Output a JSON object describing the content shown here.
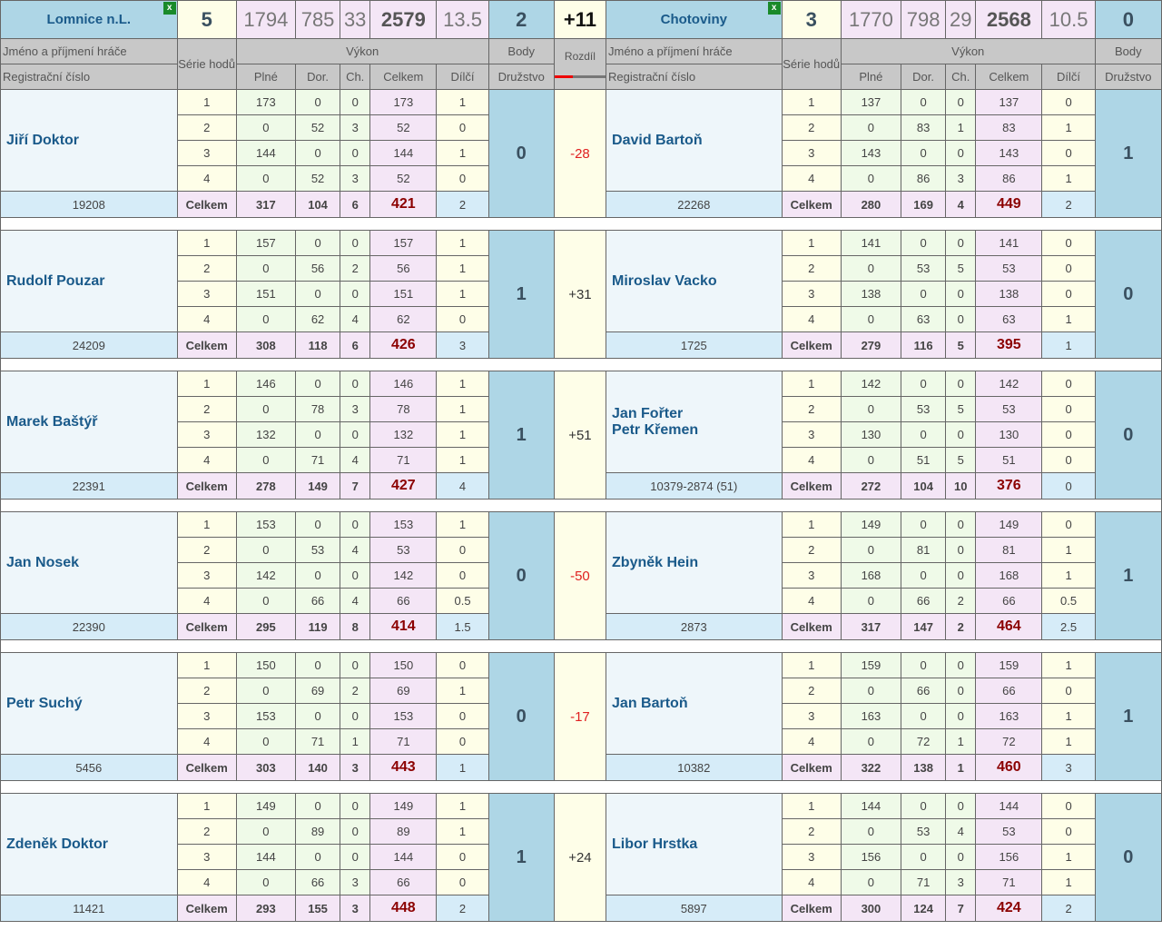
{
  "header": {
    "home": {
      "name": "Lomnice n.L.",
      "icon": "excel-icon",
      "icon_glyph": "x",
      "points": "5",
      "plne": "1794",
      "dor": "785",
      "ch": "33",
      "celkem": "2579",
      "dilci": "13.5",
      "body": "2"
    },
    "diff": "+11",
    "away": {
      "name": "Chotoviny",
      "icon": "excel-icon",
      "icon_glyph": "x",
      "points": "3",
      "plne": "1770",
      "dor": "798",
      "ch": "29",
      "celkem": "2568",
      "dilci": "10.5",
      "body": "0"
    }
  },
  "labels": {
    "player": "Jméno a příjmení hráče",
    "reg": "Registrační číslo",
    "serie": "Série hodů",
    "vykon": "Výkon",
    "body": "Body",
    "druzstvo": "Družstvo",
    "rozdil": "Rozdíl",
    "plne": "Plné",
    "dor": "Dor.",
    "ch": "Ch.",
    "celkem": "Celkem",
    "dilci": "Dílčí",
    "total_label": "Celkem"
  },
  "matches": [
    {
      "diff": "-28",
      "home": {
        "names": [
          "Jiří Doktor"
        ],
        "reg": "19208",
        "points": "0",
        "rows": [
          [
            "1",
            "173",
            "0",
            "0",
            "173",
            "1"
          ],
          [
            "2",
            "0",
            "52",
            "3",
            "52",
            "0"
          ],
          [
            "3",
            "144",
            "0",
            "0",
            "144",
            "1"
          ],
          [
            "4",
            "0",
            "52",
            "3",
            "52",
            "0"
          ]
        ],
        "total": [
          "317",
          "104",
          "6",
          "421",
          "2"
        ]
      },
      "away": {
        "names": [
          "David Bartoň"
        ],
        "reg": "22268",
        "points": "1",
        "rows": [
          [
            "1",
            "137",
            "0",
            "0",
            "137",
            "0"
          ],
          [
            "2",
            "0",
            "83",
            "1",
            "83",
            "1"
          ],
          [
            "3",
            "143",
            "0",
            "0",
            "143",
            "0"
          ],
          [
            "4",
            "0",
            "86",
            "3",
            "86",
            "1"
          ]
        ],
        "total": [
          "280",
          "169",
          "4",
          "449",
          "2"
        ]
      }
    },
    {
      "diff": "+31",
      "home": {
        "names": [
          "Rudolf Pouzar"
        ],
        "reg": "24209",
        "points": "1",
        "rows": [
          [
            "1",
            "157",
            "0",
            "0",
            "157",
            "1"
          ],
          [
            "2",
            "0",
            "56",
            "2",
            "56",
            "1"
          ],
          [
            "3",
            "151",
            "0",
            "0",
            "151",
            "1"
          ],
          [
            "4",
            "0",
            "62",
            "4",
            "62",
            "0"
          ]
        ],
        "total": [
          "308",
          "118",
          "6",
          "426",
          "3"
        ]
      },
      "away": {
        "names": [
          "Miroslav Vacko"
        ],
        "reg": "1725",
        "points": "0",
        "rows": [
          [
            "1",
            "141",
            "0",
            "0",
            "141",
            "0"
          ],
          [
            "2",
            "0",
            "53",
            "5",
            "53",
            "0"
          ],
          [
            "3",
            "138",
            "0",
            "0",
            "138",
            "0"
          ],
          [
            "4",
            "0",
            "63",
            "0",
            "63",
            "1"
          ]
        ],
        "total": [
          "279",
          "116",
          "5",
          "395",
          "1"
        ]
      }
    },
    {
      "diff": "+51",
      "home": {
        "names": [
          "Marek Baštýř"
        ],
        "reg": "22391",
        "points": "1",
        "rows": [
          [
            "1",
            "146",
            "0",
            "0",
            "146",
            "1"
          ],
          [
            "2",
            "0",
            "78",
            "3",
            "78",
            "1"
          ],
          [
            "3",
            "132",
            "0",
            "0",
            "132",
            "1"
          ],
          [
            "4",
            "0",
            "71",
            "4",
            "71",
            "1"
          ]
        ],
        "total": [
          "278",
          "149",
          "7",
          "427",
          "4"
        ]
      },
      "away": {
        "names": [
          "Jan Fořter",
          "Petr Křemen"
        ],
        "reg": "10379-2874 (51)",
        "points": "0",
        "rows": [
          [
            "1",
            "142",
            "0",
            "0",
            "142",
            "0"
          ],
          [
            "2",
            "0",
            "53",
            "5",
            "53",
            "0"
          ],
          [
            "3",
            "130",
            "0",
            "0",
            "130",
            "0"
          ],
          [
            "4",
            "0",
            "51",
            "5",
            "51",
            "0"
          ]
        ],
        "total": [
          "272",
          "104",
          "10",
          "376",
          "0"
        ]
      }
    },
    {
      "diff": "-50",
      "home": {
        "names": [
          "Jan Nosek"
        ],
        "reg": "22390",
        "points": "0",
        "rows": [
          [
            "1",
            "153",
            "0",
            "0",
            "153",
            "1"
          ],
          [
            "2",
            "0",
            "53",
            "4",
            "53",
            "0"
          ],
          [
            "3",
            "142",
            "0",
            "0",
            "142",
            "0"
          ],
          [
            "4",
            "0",
            "66",
            "4",
            "66",
            "0.5"
          ]
        ],
        "total": [
          "295",
          "119",
          "8",
          "414",
          "1.5"
        ]
      },
      "away": {
        "names": [
          "Zbyněk Hein"
        ],
        "reg": "2873",
        "points": "1",
        "rows": [
          [
            "1",
            "149",
            "0",
            "0",
            "149",
            "0"
          ],
          [
            "2",
            "0",
            "81",
            "0",
            "81",
            "1"
          ],
          [
            "3",
            "168",
            "0",
            "0",
            "168",
            "1"
          ],
          [
            "4",
            "0",
            "66",
            "2",
            "66",
            "0.5"
          ]
        ],
        "total": [
          "317",
          "147",
          "2",
          "464",
          "2.5"
        ]
      }
    },
    {
      "diff": "-17",
      "home": {
        "names": [
          "Petr Suchý"
        ],
        "reg": "5456",
        "points": "0",
        "rows": [
          [
            "1",
            "150",
            "0",
            "0",
            "150",
            "0"
          ],
          [
            "2",
            "0",
            "69",
            "2",
            "69",
            "1"
          ],
          [
            "3",
            "153",
            "0",
            "0",
            "153",
            "0"
          ],
          [
            "4",
            "0",
            "71",
            "1",
            "71",
            "0"
          ]
        ],
        "total": [
          "303",
          "140",
          "3",
          "443",
          "1"
        ]
      },
      "away": {
        "names": [
          "Jan Bartoň"
        ],
        "reg": "10382",
        "points": "1",
        "rows": [
          [
            "1",
            "159",
            "0",
            "0",
            "159",
            "1"
          ],
          [
            "2",
            "0",
            "66",
            "0",
            "66",
            "0"
          ],
          [
            "3",
            "163",
            "0",
            "0",
            "163",
            "1"
          ],
          [
            "4",
            "0",
            "72",
            "1",
            "72",
            "1"
          ]
        ],
        "total": [
          "322",
          "138",
          "1",
          "460",
          "3"
        ]
      }
    },
    {
      "diff": "+24",
      "home": {
        "names": [
          "Zdeněk Doktor"
        ],
        "reg": "11421",
        "points": "1",
        "rows": [
          [
            "1",
            "149",
            "0",
            "0",
            "149",
            "1"
          ],
          [
            "2",
            "0",
            "89",
            "0",
            "89",
            "1"
          ],
          [
            "3",
            "144",
            "0",
            "0",
            "144",
            "0"
          ],
          [
            "4",
            "0",
            "66",
            "3",
            "66",
            "0"
          ]
        ],
        "total": [
          "293",
          "155",
          "3",
          "448",
          "2"
        ]
      },
      "away": {
        "names": [
          "Libor Hrstka"
        ],
        "reg": "5897",
        "points": "0",
        "rows": [
          [
            "1",
            "144",
            "0",
            "0",
            "144",
            "0"
          ],
          [
            "2",
            "0",
            "53",
            "4",
            "53",
            "0"
          ],
          [
            "3",
            "156",
            "0",
            "0",
            "156",
            "1"
          ],
          [
            "4",
            "0",
            "71",
            "3",
            "71",
            "1"
          ]
        ],
        "total": [
          "300",
          "124",
          "7",
          "424",
          "2"
        ]
      }
    }
  ]
}
